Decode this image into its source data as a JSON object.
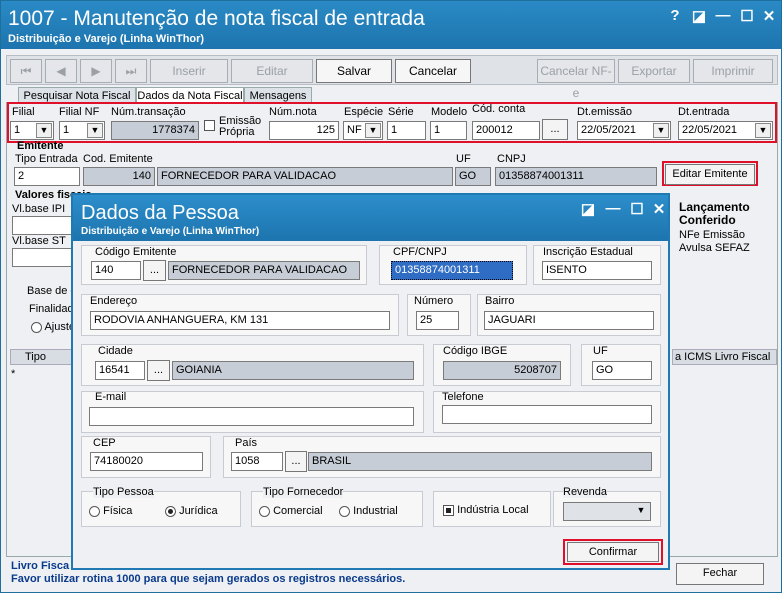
{
  "window": {
    "title": "1007 - Manutenção de nota fiscal de entrada",
    "subtitle": "Distribuição e Varejo (Linha WinThor)",
    "controls": [
      "?",
      "◪",
      "—",
      "☐",
      "✕"
    ]
  },
  "toolbar": {
    "first": "⏮",
    "prev": "◀",
    "next": "▶",
    "last": "⏭",
    "insert": "Inserir",
    "edit": "Editar",
    "save": "Salvar",
    "cancel": "Cancelar",
    "cancel_nfe": "Cancelar NF-e",
    "export": "Exportar",
    "print": "Imprimir"
  },
  "tabs": [
    "Pesquisar Nota Fiscal",
    "Dados da Nota Fiscal",
    "Mensagens"
  ],
  "header_fields": {
    "filial_label": "Filial",
    "filial_value": "1",
    "filial_nf_label": "Filial NF",
    "filial_nf_value": "1",
    "num_transacao_label": "Núm.transação",
    "num_transacao_value": "1778374",
    "emissao_propria_label": "Emissão Própria",
    "num_nota_label": "Núm.nota",
    "num_nota_value": "125",
    "especie_label": "Espécie",
    "especie_value": "NF",
    "serie_label": "Série",
    "serie_value": "1",
    "modelo_label": "Modelo",
    "modelo_value": "1",
    "cod_conta_label": "Cód. conta",
    "cod_conta_value": "200012",
    "dt_emissao_label": "Dt.emissão",
    "dt_emissao_value": "22/05/2021",
    "dt_entrada_label": "Dt.entrada",
    "dt_entrada_value": "22/05/2021"
  },
  "emitente": {
    "section": "Emitente",
    "tipo_entrada_label": "Tipo Entrada",
    "tipo_entrada_value": "2",
    "cod_emitente_label": "Cod. Emitente",
    "cod_emitente_value": "140",
    "name_value": "FORNECEDOR PARA VALIDACAO",
    "uf_label": "UF",
    "uf_value": "GO",
    "cnpj_label": "CNPJ",
    "cnpj_value": "01358874001311",
    "edit_button": "Editar Emitente"
  },
  "background_fields": {
    "valores_fiscais": "Valores fiscais",
    "vl_base_ipi": "Vl.base IPI",
    "vl_base_st": "Vl.base ST",
    "base_de": "Base de c",
    "finalidade": "Finalidad",
    "ajuste": "Ajuste",
    "tipo_col": "Tipo",
    "icms_col": "a ICMS Livro Fiscal",
    "lancamento": "Lançamento Conferido",
    "nfe_emissao": "NFe Emissão Avulsa SEFAZ",
    "livro_fiscal": "Livro Fisca",
    "footer_msg": "Favor utilizar rotina 1000 para que sejam gerados os registros necessários.",
    "close_button": "Fechar"
  },
  "dialog": {
    "title": "Dados da Pessoa",
    "subtitle": "Distribuição e Varejo (Linha WinThor)",
    "codigo_emitente_label": "Código Emitente",
    "codigo_emitente_value": "140",
    "nome_value": "FORNECEDOR PARA VALIDACAO",
    "cpf_cnpj_label": "CPF/CNPJ",
    "cpf_cnpj_value": "01358874001311",
    "ie_label": "Inscrição Estadual",
    "ie_value": "ISENTO",
    "endereco_label": "Endereço",
    "endereco_value": "RODOVIA ANHANGUERA, KM 131",
    "numero_label": "Número",
    "numero_value": "25",
    "bairro_label": "Bairro",
    "bairro_value": "JAGUARI",
    "cidade_label": "Cidade",
    "cidade_code": "16541",
    "cidade_name": "GOIANIA",
    "ibge_label": "Código IBGE",
    "ibge_value": "5208707",
    "uf_label": "UF",
    "uf_value": "GO",
    "email_label": "E-mail",
    "email_value": "",
    "telefone_label": "Telefone",
    "telefone_value": "",
    "cep_label": "CEP",
    "cep_value": "74180020",
    "pais_label": "País",
    "pais_code": "1058",
    "pais_name": "BRASIL",
    "tipo_pessoa_label": "Tipo Pessoa",
    "fisica": "Física",
    "juridica": "Jurídica",
    "tipo_fornecedor_label": "Tipo Fornecedor",
    "comercial": "Comercial",
    "industrial": "Industrial",
    "industria_local": "Indústria Local",
    "revenda_label": "Revenda",
    "confirm_button": "Confirmar",
    "lookup": "..."
  },
  "colors": {
    "title_blue": "#1d74ae",
    "highlight_red": "#e0102a",
    "readonly_gray": "#c6cdd6"
  }
}
